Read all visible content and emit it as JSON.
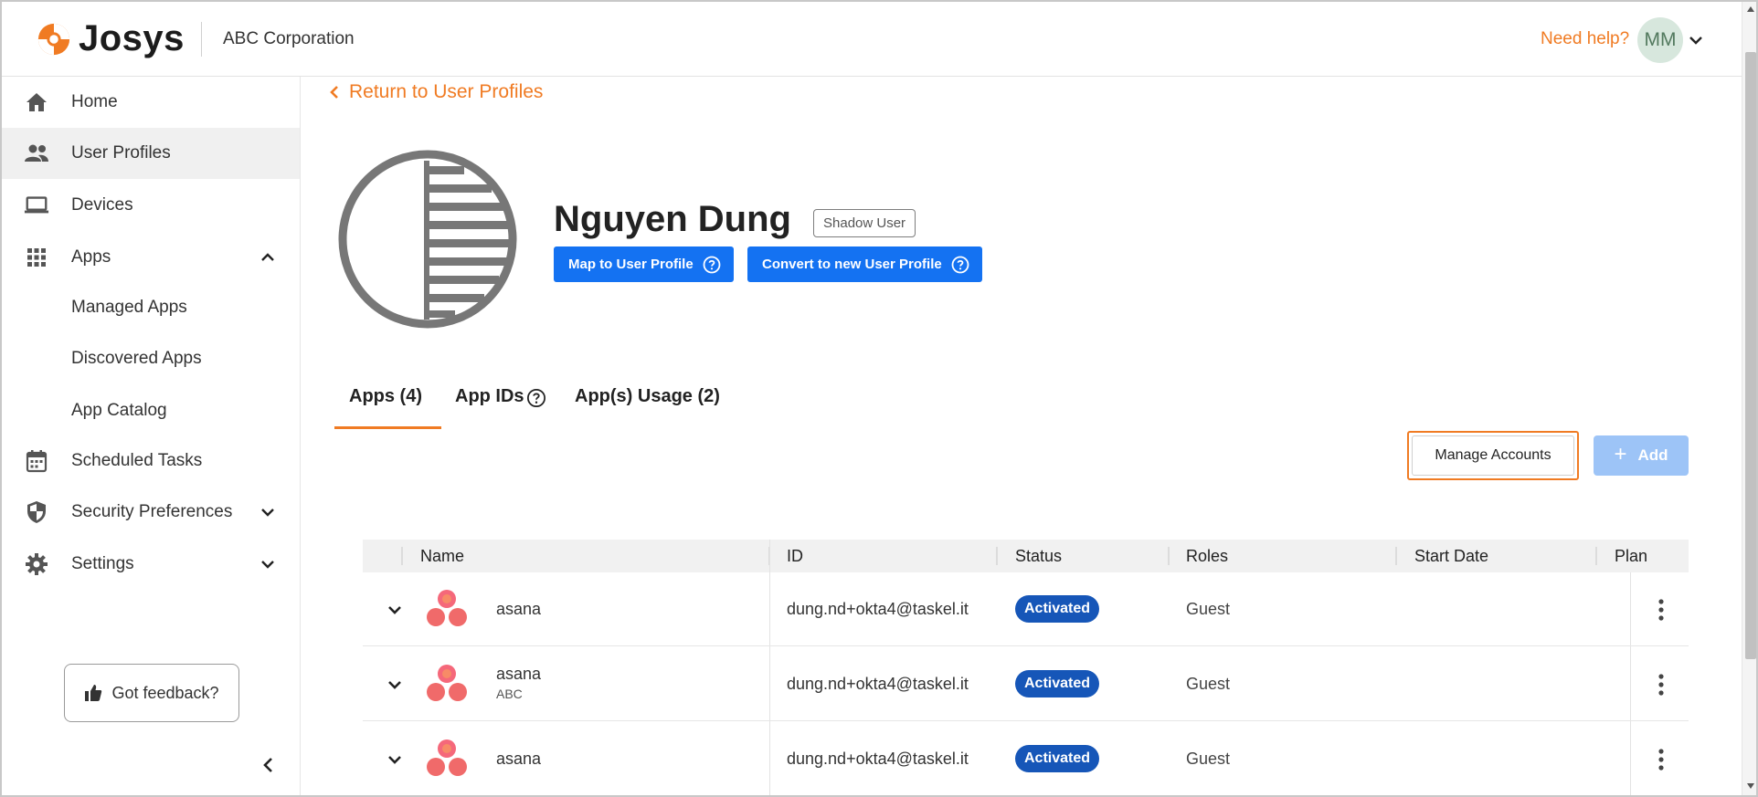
{
  "header": {
    "logo_text": "Josys",
    "org_name": "ABC Corporation",
    "need_help": "Need help?",
    "avatar_initials": "MM",
    "brand_color": "#f07b23"
  },
  "sidebar": {
    "items": [
      {
        "label": "Home",
        "icon": "home-icon"
      },
      {
        "label": "User Profiles",
        "icon": "people-icon",
        "active": true
      },
      {
        "label": "Devices",
        "icon": "laptop-icon"
      },
      {
        "label": "Apps",
        "icon": "apps-grid-icon",
        "expanded": true
      },
      {
        "label": "Scheduled Tasks",
        "icon": "calendar-icon"
      },
      {
        "label": "Security Preferences",
        "icon": "shield-icon"
      },
      {
        "label": "Settings",
        "icon": "gear-icon"
      }
    ],
    "apps_subitems": [
      "Managed Apps",
      "Discovered Apps",
      "App Catalog"
    ],
    "feedback_label": "Got feedback?"
  },
  "main": {
    "back_link": "Return to User Profiles",
    "user_name": "Nguyen Dung",
    "badge": "Shadow User",
    "map_button": "Map to User Profile",
    "convert_button": "Convert to new User Profile",
    "tabs": [
      "Apps (4)",
      "App IDs",
      "App(s) Usage (2)"
    ],
    "active_tab": 0,
    "manage_accounts": "Manage Accounts",
    "add_button": "Add"
  },
  "table": {
    "columns": [
      "Name",
      "ID",
      "Status",
      "Roles",
      "Start Date",
      "Plan"
    ],
    "rows": [
      {
        "name": "asana",
        "sub": "",
        "id": "dung.nd+okta4@taskel.it",
        "status": "Activated",
        "role": "Guest",
        "start_date": "",
        "plan": ""
      },
      {
        "name": "asana",
        "sub": "ABC",
        "id": "dung.nd+okta4@taskel.it",
        "status": "Activated",
        "role": "Guest",
        "start_date": "",
        "plan": ""
      },
      {
        "name": "asana",
        "sub": "",
        "id": "dung.nd+okta4@taskel.it",
        "status": "Activated",
        "role": "Guest",
        "start_date": "",
        "plan": ""
      }
    ],
    "status_color": "#1656b8"
  }
}
